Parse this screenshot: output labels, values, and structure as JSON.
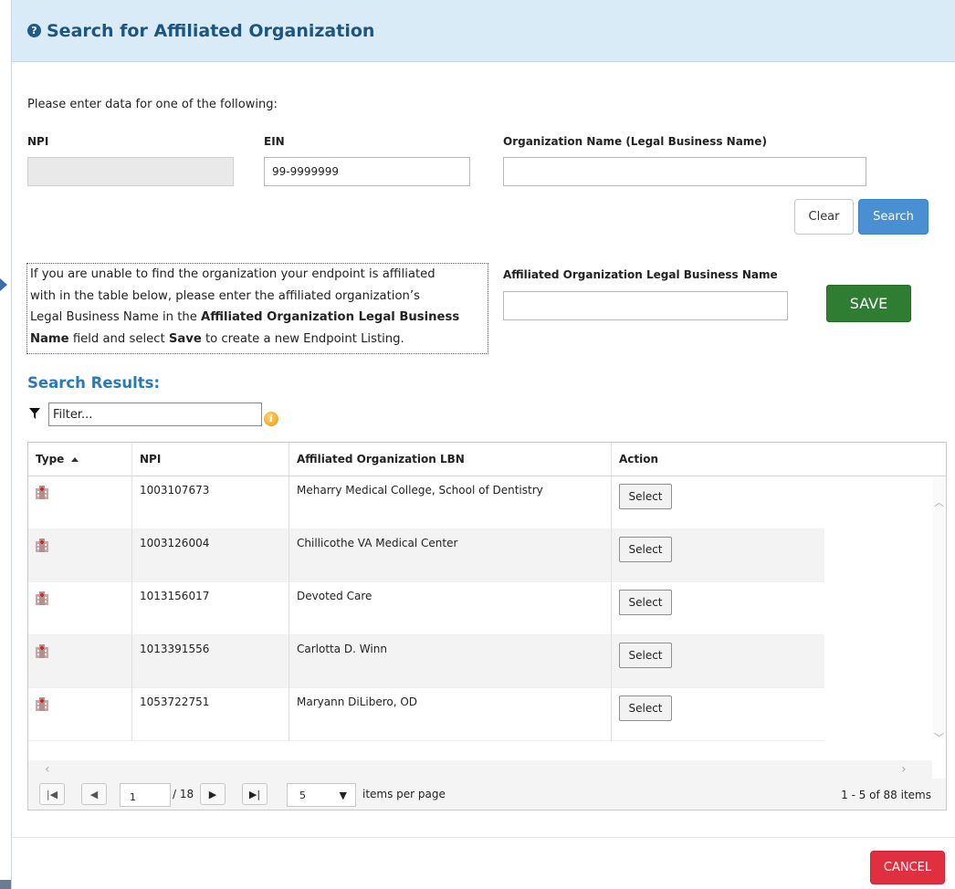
{
  "header": {
    "title": "Search for Affiliated Organization"
  },
  "instructions": "Please enter data for one of the following:",
  "fields": {
    "npi": {
      "label": "NPI",
      "value": ""
    },
    "ein": {
      "label": "EIN",
      "value": "99-9999999"
    },
    "org_name": {
      "label": "Organization Name (Legal Business Name)",
      "value": ""
    }
  },
  "buttons": {
    "clear": "Clear",
    "search": "Search",
    "save": "SAVE",
    "cancel": "CANCEL"
  },
  "info_box": {
    "line1": "If you are unable to find the organization your endpoint is affiliated",
    "line2": "with in the table below, please enter the affiliated organization’s",
    "line3_prefix": "Legal Business Name in the ",
    "line3_bold": "Affiliated Organization Legal Business",
    "line4_bold": "Name",
    "line4_mid": " field and select ",
    "line4_bold2": "Save",
    "line4_suffix": " to create a new Endpoint Listing."
  },
  "affiliated_lbn": {
    "label": "Affiliated Organization Legal Business Name",
    "value": ""
  },
  "results": {
    "title": "Search Results:",
    "filter_placeholder": "Filter...",
    "columns": [
      "Type",
      "NPI",
      "Affiliated Organization LBN",
      "Action"
    ],
    "rows": [
      {
        "type_icon": "organization-icon",
        "npi": "1003107673",
        "lbn": "Meharry Medical College, School of Dentistry",
        "action": "Select"
      },
      {
        "type_icon": "organization-icon",
        "npi": "1003126004",
        "lbn": "Chillicothe VA Medical Center",
        "action": "Select"
      },
      {
        "type_icon": "organization-icon",
        "npi": "1013156017",
        "lbn": "Devoted Care",
        "action": "Select"
      },
      {
        "type_icon": "organization-icon",
        "npi": "1013391556",
        "lbn": "Carlotta D. Winn",
        "action": "Select"
      },
      {
        "type_icon": "organization-icon",
        "npi": "1053722751",
        "lbn": "Maryann DiLibero, OD",
        "action": "Select"
      }
    ]
  },
  "pager": {
    "current_page": "1",
    "total_pages": "/ 18",
    "page_size": "5",
    "items_per_page_label": "items per page",
    "summary": "1 - 5 of 88 items"
  },
  "colors": {
    "header_bg": "#d9ebf6",
    "title": "#1c5580",
    "search": "#4a8fd1",
    "save": "#2f7d32",
    "cancel": "#e03040",
    "results_title": "#2a7ab8"
  }
}
